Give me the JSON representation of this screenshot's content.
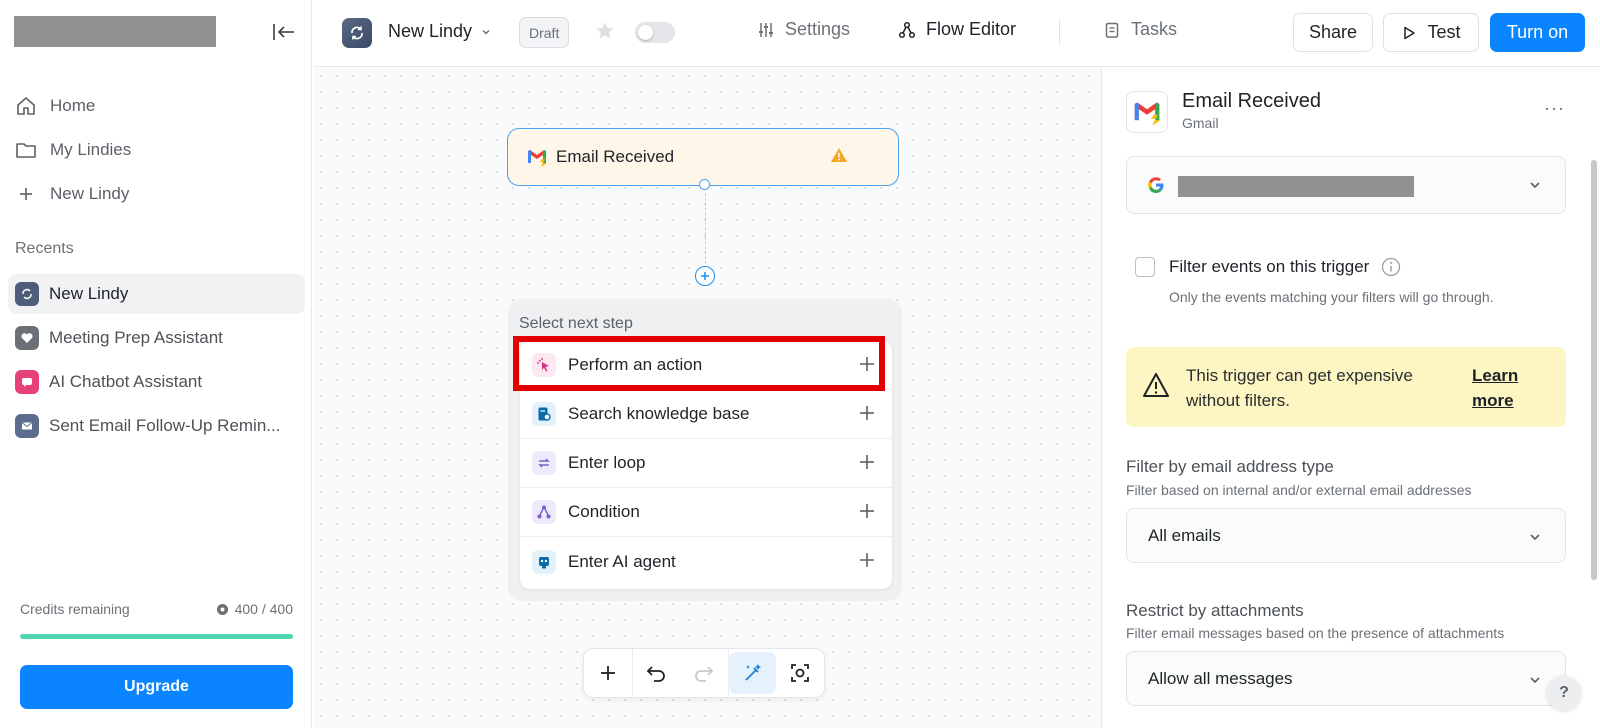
{
  "sidebar": {
    "nav": [
      {
        "label": "Home",
        "icon": "home-icon"
      },
      {
        "label": "My Lindies",
        "icon": "folder-icon"
      },
      {
        "label": "New Lindy",
        "icon": "plus-icon"
      }
    ],
    "recents_title": "Recents",
    "recents": [
      {
        "label": "New Lindy",
        "icon": "lindy-icon",
        "color": "#4e5d79"
      },
      {
        "label": "Meeting Prep Assistant",
        "icon": "heart-icon",
        "color": "#6b6f76"
      },
      {
        "label": "AI Chatbot Assistant",
        "icon": "chat-icon",
        "color": "#e8417a"
      },
      {
        "label": "Sent Email Follow-Up Remin...",
        "icon": "mail-icon",
        "color": "#5b6c8f"
      }
    ],
    "credits_label": "Credits remaining",
    "credits_value": "400 / 400",
    "credits_fraction": 1.0,
    "upgrade_label": "Upgrade"
  },
  "topbar": {
    "title": "New Lindy",
    "status": "Draft",
    "tabs": [
      {
        "label": "Settings",
        "icon": "sliders-icon"
      },
      {
        "label": "Flow Editor",
        "icon": "flow-icon"
      },
      {
        "label": "Tasks",
        "icon": "clipboard-icon"
      }
    ],
    "active_tab": "Flow Editor",
    "share_label": "Share",
    "test_label": "Test",
    "turn_on_label": "Turn on"
  },
  "canvas": {
    "trigger_label": "Email Received",
    "select_title": "Select next step",
    "steps": [
      {
        "label": "Perform an action",
        "icon": "cursor-click-icon",
        "color": "#d6338a"
      },
      {
        "label": "Search knowledge base",
        "icon": "knowledge-base-icon",
        "color": "#0b6aa8"
      },
      {
        "label": "Enter loop",
        "icon": "loop-icon",
        "color": "#7b61c9"
      },
      {
        "label": "Condition",
        "icon": "condition-icon",
        "color": "#7b61c9"
      },
      {
        "label": "Enter AI agent",
        "icon": "robot-icon",
        "color": "#0b6aa8"
      }
    ]
  },
  "panel": {
    "title": "Email Received",
    "subtitle": "Gmail",
    "filter_label": "Filter events on this trigger",
    "filter_desc": "Only the events matching your filters will go through.",
    "warning_text": "This trigger can get expensive without filters.",
    "warning_link": "Learn more",
    "address_title": "Filter by email address type",
    "address_desc": "Filter based on internal and/or external email addresses",
    "address_value": "All emails",
    "attach_title": "Restrict by attachments",
    "attach_desc": "Filter email messages based on the presence of attachments",
    "attach_value": "Allow all messages",
    "help_label": "?"
  },
  "colors": {
    "accent": "#0a84ff",
    "highlight": "#e20000",
    "warning_bg": "#fdf6c3",
    "progress": "#4dd4b0"
  }
}
